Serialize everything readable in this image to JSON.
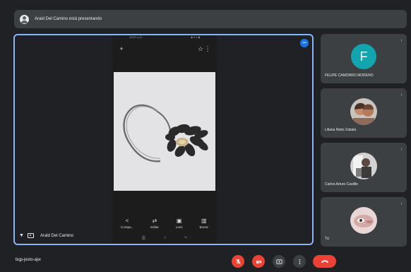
{
  "banner": {
    "icon": "person-icon",
    "text": "Araid Del Camino está presentando"
  },
  "presentation": {
    "status_left": "10:57 ▴ ◎ ·",
    "status_right": "◈ ▾ 1 ▮",
    "toolbar": {
      "back": "+",
      "star": "☆",
      "more": "⋮"
    },
    "actions": [
      {
        "glyph": "<",
        "label": "Compa..."
      },
      {
        "glyph": "⇄",
        "label": "Editar"
      },
      {
        "glyph": "▣",
        "label": "Lens"
      },
      {
        "glyph": "▥",
        "label": "Borrar"
      }
    ],
    "nav": [
      "|||",
      "○",
      "<"
    ],
    "presenter_name": "Arald Del Camino",
    "more_button": "•••"
  },
  "participants": [
    {
      "name": "FELIPE CAMORRO MORENO",
      "avatar_type": "letter",
      "letter": "F",
      "avatar_color": "#12a4af",
      "mic": "mic-off-icon"
    },
    {
      "name": "Liliana Nieto Zabala",
      "avatar_type": "photo",
      "mic": "mic-off-icon"
    },
    {
      "name": "Carlos Arturo Castillo",
      "avatar_type": "photo",
      "mic": "mic-off-icon"
    },
    {
      "name": "Tú",
      "avatar_type": "photo",
      "mic": "mic-off-icon"
    }
  ],
  "bottom_bar": {
    "meeting_code": "bqp-jesto-ajw",
    "controls": [
      {
        "name": "mic-toggle-button",
        "icon": "mic-off-icon",
        "color": "#ea4335"
      },
      {
        "name": "camera-toggle-button",
        "icon": "camera-off-icon",
        "color": "#ea4335"
      },
      {
        "name": "present-now-button",
        "icon": "present-icon",
        "color": "#3c4043"
      },
      {
        "name": "more-options-button",
        "icon": "more-vert-icon",
        "color": "#3c4043"
      },
      {
        "name": "leave-call-button",
        "icon": "hang-up-icon",
        "color": "#ea4335"
      }
    ]
  },
  "colors": {
    "background": "#202124",
    "tile": "#3c4043",
    "active_border": "#8ab4f8",
    "danger": "#ea4335"
  }
}
